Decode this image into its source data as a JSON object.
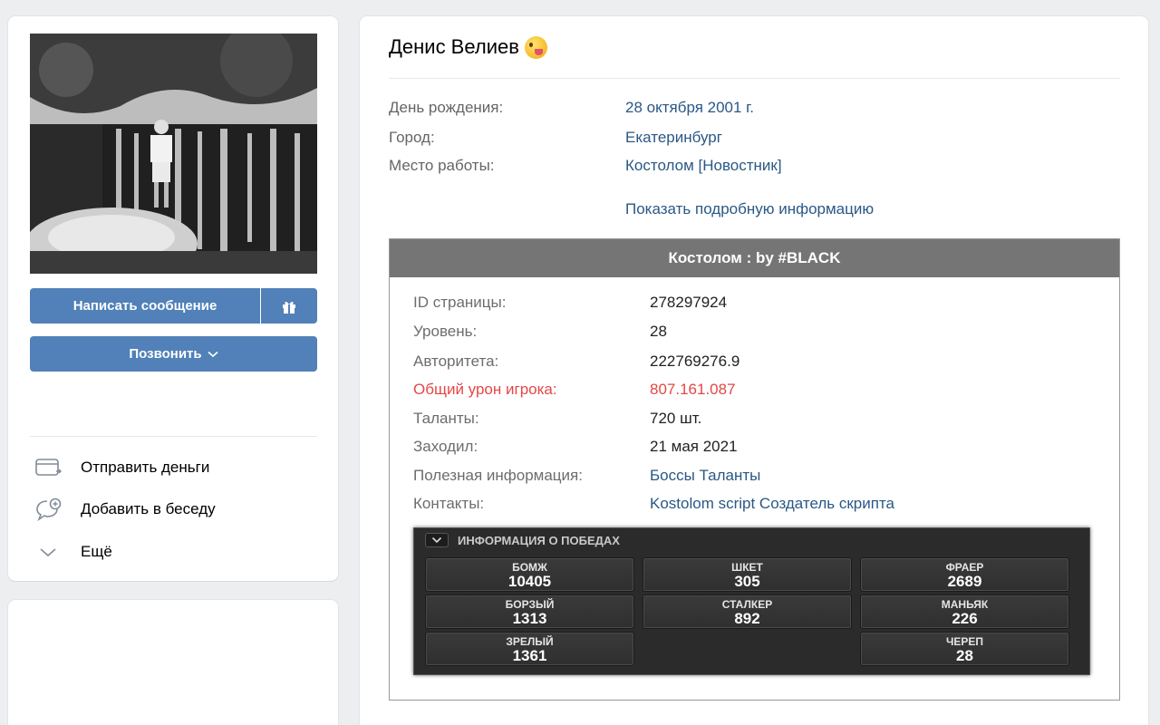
{
  "profile": {
    "send_message_label": "Написать сообщение",
    "call_label": "Позвонить",
    "actions": [
      {
        "label": "Отправить деньги",
        "icon": "wallet-icon"
      },
      {
        "label": "Добавить в беседу",
        "icon": "add-chat-icon"
      },
      {
        "label": "Ещё",
        "icon": "chevron-down-icon"
      }
    ]
  },
  "main": {
    "name": "Денис Велиев",
    "info": [
      {
        "label": "День рождения:",
        "value": "28 октября 2001 г."
      },
      {
        "label": "Город:",
        "value": "Екатеринбург"
      },
      {
        "label": "Место работы:",
        "value": "Костолом [Новостник]"
      }
    ],
    "show_more": "Показать подробную информацию"
  },
  "app": {
    "title": "Костолом : by #BLACK",
    "rows": [
      {
        "label": "ID страницы:",
        "value": "278297924"
      },
      {
        "label": "Уровень:",
        "value": "28"
      },
      {
        "label": "Авторитета:",
        "value": "222769276.9"
      },
      {
        "label": "Общий урон игрока:",
        "value": "807.161.087"
      },
      {
        "label": "Таланты:",
        "value": "720 шт."
      },
      {
        "label": "Заходил:",
        "value": "21 мая 2021"
      },
      {
        "label": "Полезная информация:",
        "value": "Боссы Таланты"
      },
      {
        "label": "Контакты:",
        "value": "Kostolom script Создатель скрипта"
      }
    ],
    "wins_title": "ИНФОРМАЦИЯ О ПОБЕДАХ",
    "wins": [
      {
        "label": "БОМЖ",
        "value": "10405"
      },
      {
        "label": "ШКЕТ",
        "value": "305"
      },
      {
        "label": "ФРАЕР",
        "value": "2689"
      },
      {
        "label": "БОРЗЫЙ",
        "value": "1313"
      },
      {
        "label": "СТАЛКЕР",
        "value": "892"
      },
      {
        "label": "МАНЬЯК",
        "value": "226"
      },
      {
        "label": "ЗРЕЛЫЙ",
        "value": "1361"
      },
      {
        "label": "ЧЕРЕП",
        "value": "28"
      }
    ]
  },
  "colors": {
    "accent": "#5181b8",
    "link": "#2a5885",
    "damage": "#e64646",
    "header_bg": "#757575"
  }
}
